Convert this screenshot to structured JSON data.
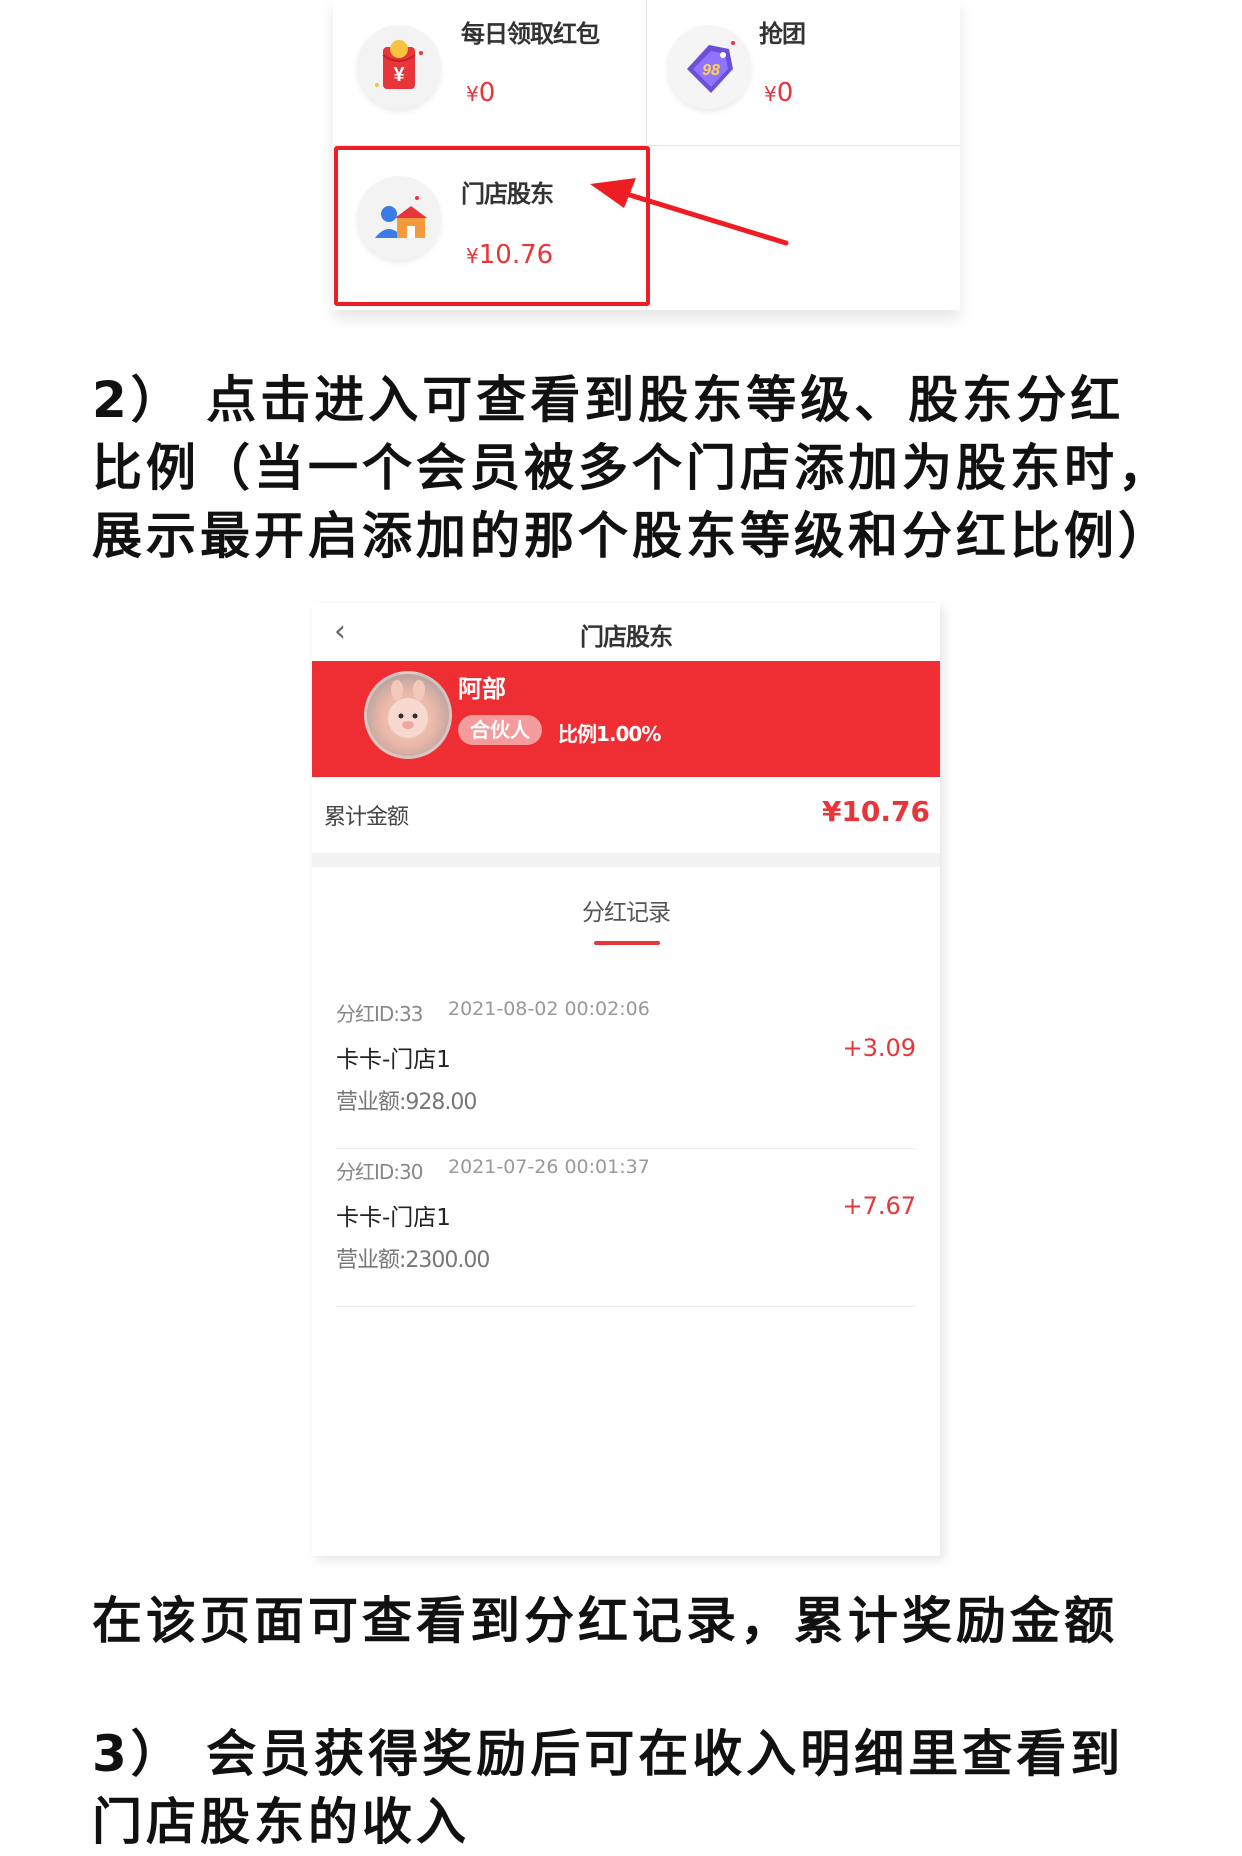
{
  "menu": {
    "items": [
      {
        "title": "每日领取红包",
        "currency": "¥",
        "amount": "0"
      },
      {
        "title": "抢团",
        "currency": "¥",
        "amount": "0"
      },
      {
        "title": "门店股东",
        "currency": "¥",
        "amount": "10.76"
      }
    ],
    "icons": [
      "red-envelope-icon",
      "group-buy-tag-icon",
      "store-shareholder-icon"
    ],
    "highlight_color": "#ee1d24"
  },
  "step2": {
    "text": "2） 点击进入可查看到股东等级、股东分红比例（当一个会员被多个门店添加为股东时，展示最开启添加的那个股东等级和分红比例）"
  },
  "phone": {
    "nav_title": "门店股东",
    "user": {
      "name": "阿部",
      "level": "合伙人",
      "ratio": "比例1.00%"
    },
    "total": {
      "label": "累计金额",
      "value": "¥10.76"
    },
    "section_title": "分红记录",
    "records": [
      {
        "id": "分红ID:33",
        "time": "2021-08-02 00:02:06",
        "store": "卡卡-门店1",
        "revenue": "营业额:928.00",
        "amount": "+3.09"
      },
      {
        "id": "分红ID:30",
        "time": "2021-07-26 00:01:37",
        "store": "卡卡-门店1",
        "revenue": "营业额:2300.00",
        "amount": "+7.67"
      }
    ],
    "accent_color": "#ee2e33"
  },
  "note": {
    "text": "在该页面可查看到分红记录，累计奖励金额"
  },
  "step3": {
    "text": "3） 会员获得奖励后可在收入明细里查看到门店股东的收入"
  }
}
